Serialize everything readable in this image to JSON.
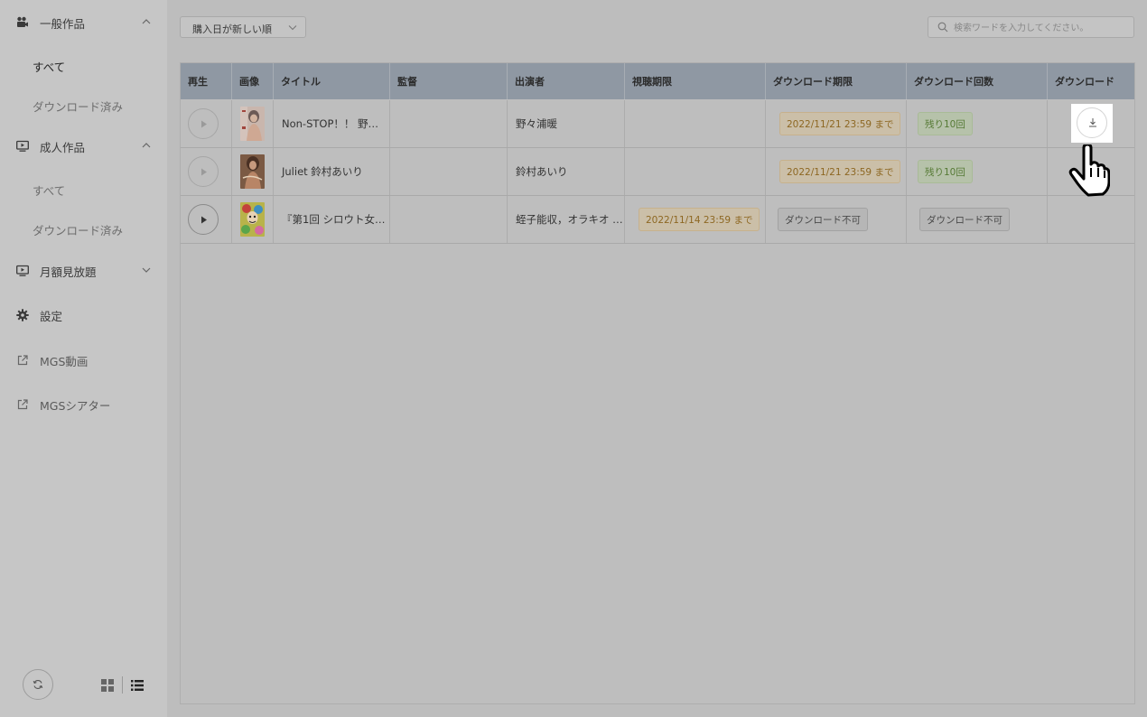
{
  "sidebar": {
    "groups": [
      {
        "label": "一般作品",
        "icon": "video-camera-icon",
        "expanded": true,
        "children": [
          {
            "label": "すべて",
            "active": true
          },
          {
            "label": "ダウンロード済み",
            "active": false
          }
        ]
      },
      {
        "label": "成人作品",
        "icon": "monitor-play-icon",
        "expanded": true,
        "children": [
          {
            "label": "すべて",
            "active": false
          },
          {
            "label": "ダウンロード済み",
            "active": false
          }
        ]
      },
      {
        "label": "月額見放題",
        "icon": "monitor-play-icon",
        "expanded": false
      },
      {
        "label": "設定",
        "icon": "gear-icon"
      },
      {
        "label": "MGS動画",
        "icon": "external-link-icon"
      },
      {
        "label": "MGSシアター",
        "icon": "external-link-icon"
      }
    ]
  },
  "toolbar": {
    "sort_value": "購入日が新しい順",
    "search_placeholder": "検索ワードを入力してください。"
  },
  "table": {
    "headers": [
      "再生",
      "画像",
      "タイトル",
      "監督",
      "出演者",
      "視聴期限",
      "ダウンロード期限",
      "ダウンロード回数",
      "ダウンロード"
    ],
    "rows": [
      {
        "title": "Non-STOP！！ 野…",
        "director": "",
        "performer": "野々浦暖",
        "view_limit": "",
        "download_limit": "2022/11/21 23:59 まで",
        "download_count": "残り10回",
        "downloadable": true
      },
      {
        "title": "Juliet 鈴村あいり",
        "director": "",
        "performer": "鈴村あいり",
        "view_limit": "",
        "download_limit": "2022/11/21 23:59 まで",
        "download_count": "残り10回",
        "downloadable": true
      },
      {
        "title": "『第1回 シロウト女…",
        "director": "",
        "performer": "蛭子能収，オラキオ …",
        "view_limit": "2022/11/14 23:59 まで",
        "download_limit": "ダウンロード不可",
        "download_count": "ダウンロード不可",
        "downloadable": false
      }
    ]
  },
  "colors": {
    "header_bg": "#8f98a3",
    "badge_orange": "#8d6722",
    "badge_green": "#567a35"
  }
}
